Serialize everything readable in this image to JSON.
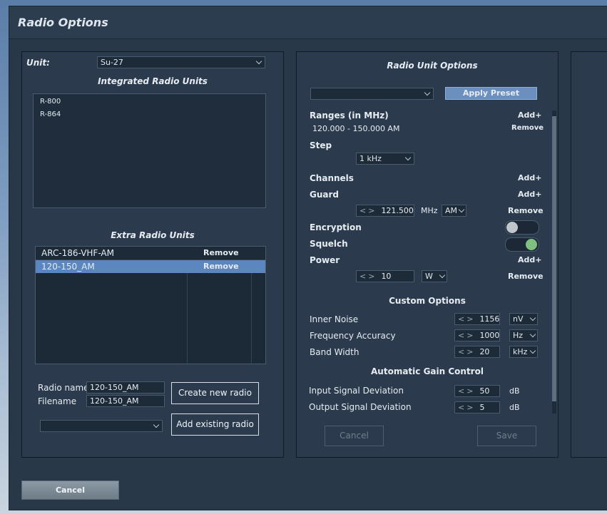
{
  "window": {
    "title": "Radio Options"
  },
  "left": {
    "unit_label": "Unit:",
    "unit_value": "Su-27",
    "integrated_title": "Integrated Radio Units",
    "integrated_items": [
      "R-800",
      "R-864"
    ],
    "extra_title": "Extra Radio Units",
    "extra_rows": [
      {
        "name": "ARC-186-VHF-AM",
        "action": "Remove"
      },
      {
        "name": "120-150_AM",
        "action": "Remove"
      }
    ],
    "radio_name_label": "Radio name",
    "radio_name_value": "120-150_AM",
    "filename_label": "Filename",
    "filename_value": "120-150_AM",
    "create_button": "Create new radio",
    "add_existing_button": "Add existing radio"
  },
  "mid": {
    "title": "Radio Unit Options",
    "apply_preset": "Apply Preset",
    "ranges_label": "Ranges (in MHz)",
    "ranges_add": "Add+",
    "range_value": "120.000 - 150.000 AM",
    "range_remove": "Remove",
    "step_label": "Step",
    "step_value": "1 kHz",
    "channels_label": "Channels",
    "channels_add": "Add+",
    "guard_label": "Guard",
    "guard_add": "Add+",
    "guard_value": "121.500",
    "guard_unit": "MHz",
    "guard_mod": "AM",
    "guard_remove": "Remove",
    "encryption_label": "Encryption",
    "squelch_label": "Squelch",
    "power_label": "Power",
    "power_add": "Add+",
    "power_value": "10",
    "power_unit": "W",
    "power_remove": "Remove",
    "custom_title": "Custom Options",
    "custom": [
      {
        "label": "Inner Noise",
        "value": "1156",
        "unit": "nV"
      },
      {
        "label": "Frequency Accuracy",
        "value": "1000",
        "unit": "Hz"
      },
      {
        "label": "Band Width",
        "value": "20",
        "unit": "kHz"
      }
    ],
    "agc_title": "Automatic Gain Control",
    "agc": [
      {
        "label": "Input Signal Deviation",
        "value": "50",
        "unit": "dB"
      },
      {
        "label": "Output Signal Deviation",
        "value": "5",
        "unit": "dB"
      }
    ],
    "cancel": "Cancel",
    "save": "Save"
  },
  "footer": {
    "cancel": "Cancel"
  },
  "colors": {
    "accent_selection": "#5b86bf",
    "toggle_on": "#7fbf7f",
    "toggle_off": "#c0c6cc"
  },
  "state": {
    "encryption_on": false,
    "squelch_on": true
  }
}
